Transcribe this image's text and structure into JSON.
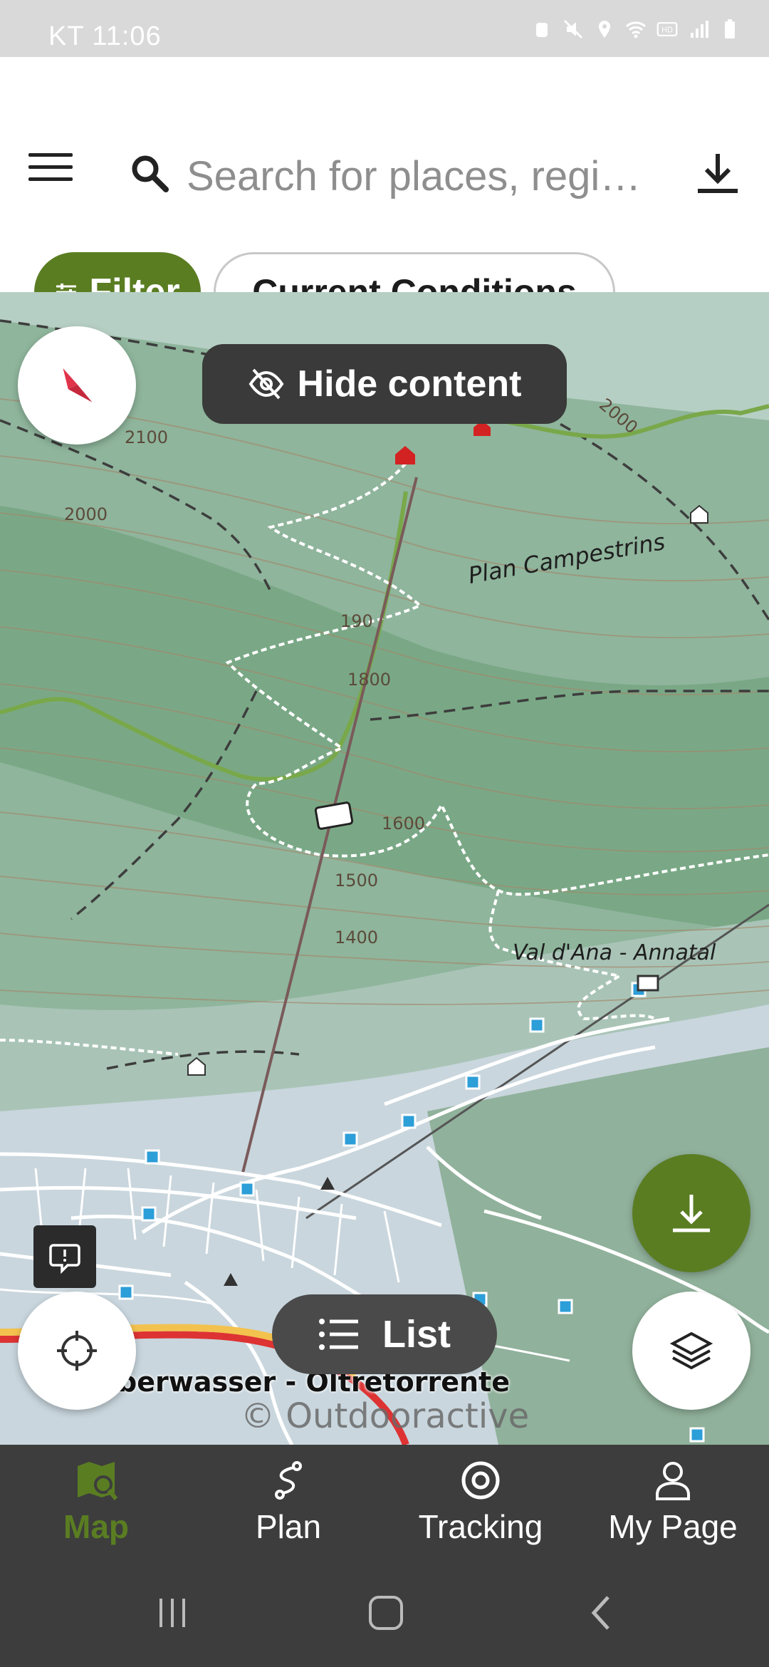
{
  "status_bar": {
    "time": "KT 11:06"
  },
  "header": {
    "search_placeholder": "Search for places, regi…",
    "filter_label": "Filter",
    "conditions_label": "Current Conditions"
  },
  "map": {
    "hide_content_label": "Hide content",
    "list_label": "List",
    "attribution": "© Outdooractive",
    "labels": {
      "plan_campestrins": "Plan Campestrins",
      "val_dana": "Val d'Ana - Annatal",
      "place_bottom": "berwasser - Oltretorrente"
    },
    "contours": {
      "c2100": "2100",
      "c2000a": "2000",
      "c2000b": "2000",
      "c1900": "190",
      "c1800": "1800",
      "c1600": "1600",
      "c1500": "1500",
      "c1400": "1400"
    }
  },
  "bottom_nav": {
    "items": [
      {
        "label": "Map",
        "icon": "map-search-icon",
        "active": true
      },
      {
        "label": "Plan",
        "icon": "route-plan-icon",
        "active": false
      },
      {
        "label": "Tracking",
        "icon": "tracking-target-icon",
        "active": false
      },
      {
        "label": "My Page",
        "icon": "person-icon",
        "active": false
      }
    ]
  },
  "colors": {
    "accent": "#5a7d22",
    "dark_surface": "#3d3d3d",
    "map_green": "#8eb39a"
  }
}
